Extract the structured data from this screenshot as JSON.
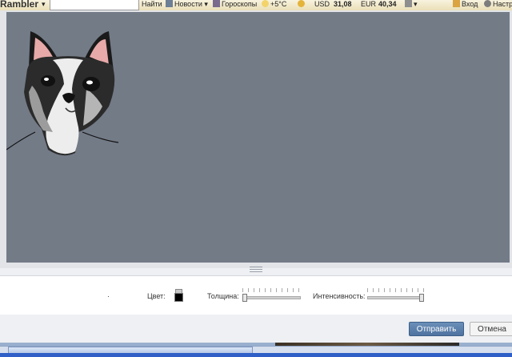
{
  "toolbar": {
    "brand": "Rambler",
    "search_value": "",
    "find_label": "Найти",
    "news_label": "Новости",
    "horoscope_label": "Гороскопы",
    "weather": "+5°C",
    "usd_label": "USD",
    "usd_value": "31,08",
    "eur_label": "EUR",
    "eur_value": "40,34",
    "login_label": "Вход",
    "settings_label": "Настр"
  },
  "drawing": {
    "background_color": "#737b87",
    "subject": "boston-terrier-sketch"
  },
  "controls": {
    "color_label": "Цвет:",
    "color_value": "#000000",
    "thickness_label": "Толщина:",
    "thickness_level": 0.0,
    "intensity_label": "Интенсивность:",
    "intensity_level": 1.0
  },
  "actions": {
    "send_label": "Отправить",
    "cancel_label": "Отмена"
  },
  "colors": {
    "canvas": "#737b87",
    "send_button": "#5b7fab",
    "toolbar": "#f1e9c9"
  }
}
